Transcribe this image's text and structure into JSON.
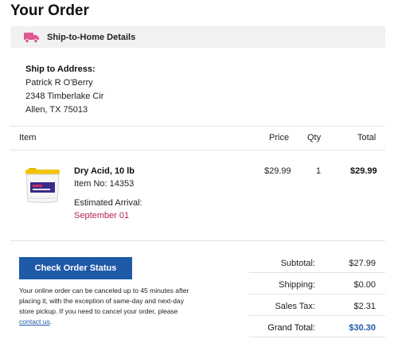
{
  "page": {
    "title": "Your Order"
  },
  "shipping": {
    "banner_label": "Ship-to-Home Details",
    "address_heading": "Ship to Address:",
    "name": "Patrick R O'Berry",
    "street": "2348 Timberlake Cir",
    "city_state_zip": "Allen, TX 75013"
  },
  "table": {
    "headers": {
      "item": "Item",
      "price": "Price",
      "qty": "Qty",
      "total": "Total"
    }
  },
  "item": {
    "name": "Dry Acid, 10 lb",
    "item_no": "Item No: 14353",
    "arrival_label": "Estimated Arrival:",
    "arrival_date": "September 01",
    "price": "$29.99",
    "qty": "1",
    "total": "$29.99"
  },
  "actions": {
    "check_status_label": "Check Order Status"
  },
  "note": {
    "text": "Your online order can be canceled up to 45 minutes after placing it, with the exception of same-day and next-day store pickup. If you need to cancel your order, please ",
    "link": "contact us",
    "end": "."
  },
  "summary": {
    "subtotal_label": "Subtotal:",
    "subtotal": "$27.99",
    "shipping_label": "Shipping:",
    "shipping": "$0.00",
    "tax_label": "Sales Tax:",
    "tax": "$2.31",
    "grand_label": "Grand Total:",
    "grand": "$30.30"
  },
  "colors": {
    "accent": "#1f5aa9",
    "arrival": "#b5225a",
    "truck": "#e0568e",
    "banner_bg": "#f1f1f1"
  },
  "icons": {
    "truck": "truck-icon"
  }
}
